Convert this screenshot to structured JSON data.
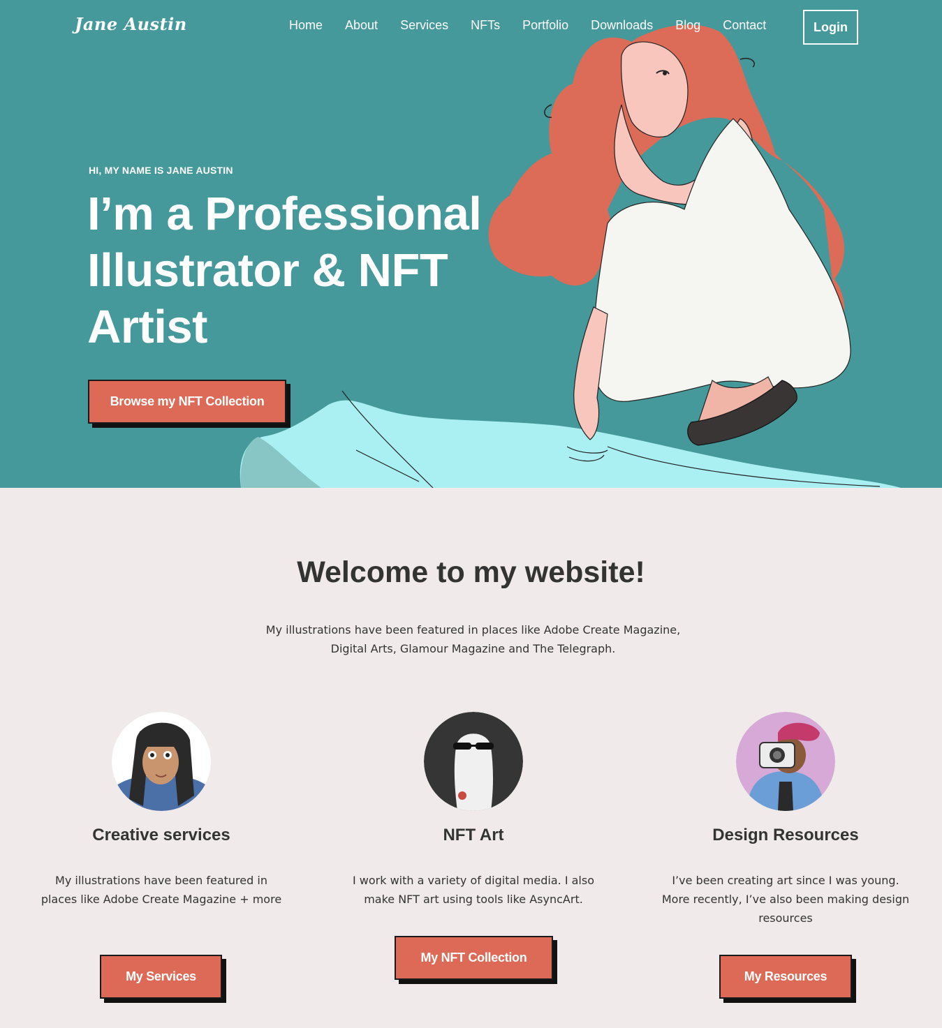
{
  "header": {
    "logo": "Jane Austin",
    "nav": [
      "Home",
      "About",
      "Services",
      "NFTs",
      "Portfolio",
      "Downloads",
      "Blog",
      "Contact"
    ],
    "login_label": "Login"
  },
  "hero": {
    "eyebrow": "HI, MY NAME IS JANE AUSTIN",
    "headline": "I’m a Professional Illustrator & NFT Artist",
    "cta_label": "Browse my NFT Collection"
  },
  "welcome": {
    "title": "Welcome to my website!",
    "text": "My illustrations have been featured in places like Adobe Create Magazine, Digital Arts, Glamour Magazine and The Telegraph."
  },
  "features": [
    {
      "title": "Creative services",
      "text": "My illustrations have been featured in places like Adobe Create Magazine + more",
      "button": "My Services",
      "icon": "girl-portrait-icon"
    },
    {
      "title": "NFT Art",
      "text": "I work with a variety of digital media. I also make NFT art using tools like AsyncArt.",
      "button": "My NFT Collection",
      "icon": "ghost-sunglasses-icon"
    },
    {
      "title": "Design Resources",
      "text": "I’ve been creating art since I was young. More recently, I’ve also been making design resources",
      "button": "My Resources",
      "icon": "photographer-icon"
    }
  ],
  "colors": {
    "hero_bg": "#45999a",
    "accent": "#dc6a57",
    "page_bg": "#f0eaea",
    "water": "#aaf0f3"
  }
}
